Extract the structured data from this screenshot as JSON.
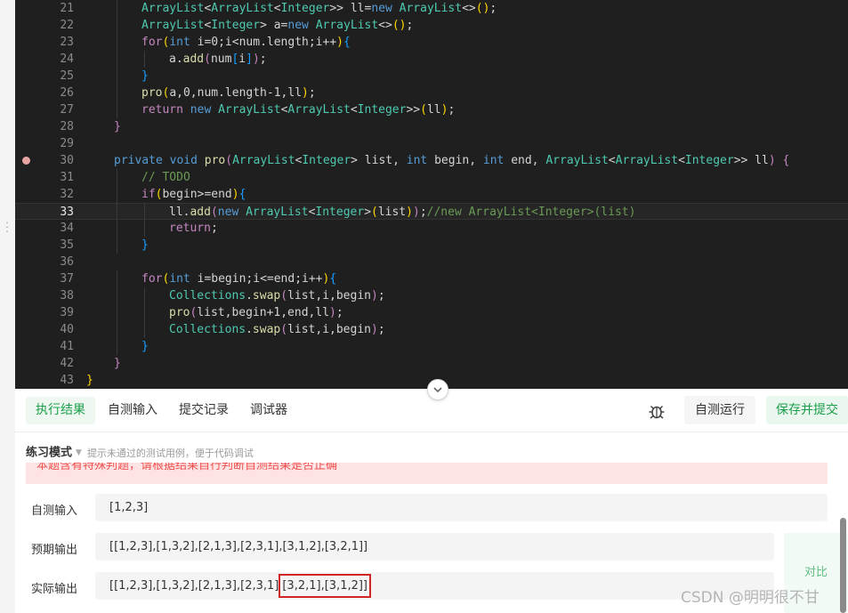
{
  "editor": {
    "lines": [
      {
        "num": "21",
        "indent": 2,
        "tokens": [
          [
            "t",
            "ArrayList"
          ],
          [
            "p",
            "<"
          ],
          [
            "t",
            "ArrayList"
          ],
          [
            "p",
            "<"
          ],
          [
            "t",
            "Integer"
          ],
          [
            "p",
            ">> ll="
          ],
          [
            "k",
            "new"
          ],
          [
            "p",
            " "
          ],
          [
            "t",
            "ArrayList"
          ],
          [
            "p",
            "<>"
          ],
          [
            "b2",
            "()"
          ],
          [
            "p",
            ";"
          ]
        ]
      },
      {
        "num": "22",
        "indent": 2,
        "tokens": [
          [
            "t",
            "ArrayList"
          ],
          [
            "p",
            "<"
          ],
          [
            "t",
            "Integer"
          ],
          [
            "p",
            "> a="
          ],
          [
            "k",
            "new"
          ],
          [
            "p",
            " "
          ],
          [
            "t",
            "ArrayList"
          ],
          [
            "p",
            "<>"
          ],
          [
            "b2",
            "()"
          ],
          [
            "p",
            ";"
          ]
        ]
      },
      {
        "num": "23",
        "indent": 2,
        "tokens": [
          [
            "b1",
            "for"
          ],
          [
            "b2",
            "("
          ],
          [
            "k",
            "int"
          ],
          [
            "p",
            " i=0;i<num.length;i++"
          ],
          [
            "b2",
            ")"
          ],
          [
            "b3",
            "{"
          ]
        ]
      },
      {
        "num": "24",
        "indent": 3,
        "tokens": [
          [
            "p",
            "a."
          ],
          [
            "f",
            "add"
          ],
          [
            "b1",
            "("
          ],
          [
            "p",
            "num"
          ],
          [
            "b3",
            "["
          ],
          [
            "p",
            "i"
          ],
          [
            "b3",
            "]"
          ],
          [
            "b1",
            ")"
          ],
          [
            "p",
            ";"
          ]
        ]
      },
      {
        "num": "25",
        "indent": 2,
        "tokens": [
          [
            "b3",
            "}"
          ]
        ]
      },
      {
        "num": "26",
        "indent": 2,
        "tokens": [
          [
            "f",
            "pro"
          ],
          [
            "b2",
            "("
          ],
          [
            "p",
            "a,0,num.length-1,ll"
          ],
          [
            "b2",
            ")"
          ],
          [
            "p",
            ";"
          ]
        ]
      },
      {
        "num": "27",
        "indent": 2,
        "tokens": [
          [
            "b1",
            "return"
          ],
          [
            "p",
            " "
          ],
          [
            "k",
            "new"
          ],
          [
            "p",
            " "
          ],
          [
            "t",
            "ArrayList"
          ],
          [
            "p",
            "<"
          ],
          [
            "t",
            "ArrayList"
          ],
          [
            "p",
            "<"
          ],
          [
            "t",
            "Integer"
          ],
          [
            "p",
            ">>"
          ],
          [
            "b2",
            "("
          ],
          [
            "p",
            "ll"
          ],
          [
            "b2",
            ")"
          ],
          [
            "p",
            ";"
          ]
        ]
      },
      {
        "num": "28",
        "indent": 1,
        "tokens": [
          [
            "b1",
            "}"
          ]
        ]
      },
      {
        "num": "29",
        "indent": 0,
        "tokens": []
      },
      {
        "num": "30",
        "indent": 1,
        "breakpoint": true,
        "tokens": [
          [
            "k",
            "private"
          ],
          [
            "p",
            " "
          ],
          [
            "k",
            "void"
          ],
          [
            "p",
            " "
          ],
          [
            "f",
            "pro"
          ],
          [
            "b1",
            "("
          ],
          [
            "t",
            "ArrayList"
          ],
          [
            "p",
            "<"
          ],
          [
            "t",
            "Integer"
          ],
          [
            "p",
            "> list, "
          ],
          [
            "k",
            "int"
          ],
          [
            "p",
            " begin, "
          ],
          [
            "k",
            "int"
          ],
          [
            "p",
            " end, "
          ],
          [
            "t",
            "ArrayList"
          ],
          [
            "p",
            "<"
          ],
          [
            "t",
            "ArrayList"
          ],
          [
            "p",
            "<"
          ],
          [
            "t",
            "Integer"
          ],
          [
            "p",
            ">> ll"
          ],
          [
            "b1",
            ")"
          ],
          [
            "p",
            " "
          ],
          [
            "b1",
            "{"
          ]
        ]
      },
      {
        "num": "31",
        "indent": 2,
        "tokens": [
          [
            "c",
            "// TODO"
          ]
        ]
      },
      {
        "num": "32",
        "indent": 2,
        "tokens": [
          [
            "b1",
            "if"
          ],
          [
            "b2",
            "("
          ],
          [
            "p",
            "begin>=end"
          ],
          [
            "b2",
            ")"
          ],
          [
            "b3",
            "{"
          ]
        ]
      },
      {
        "num": "33",
        "indent": 3,
        "current": true,
        "tokens": [
          [
            "p",
            "ll."
          ],
          [
            "f",
            "add"
          ],
          [
            "b1",
            "("
          ],
          [
            "k",
            "new"
          ],
          [
            "p",
            " "
          ],
          [
            "t",
            "ArrayList"
          ],
          [
            "p",
            "<"
          ],
          [
            "t",
            "Integer"
          ],
          [
            "p",
            ">"
          ],
          [
            "b2",
            "("
          ],
          [
            "p",
            "list"
          ],
          [
            "b2",
            ")"
          ],
          [
            "b1",
            ")"
          ],
          [
            "p",
            ";"
          ],
          [
            "c",
            "//new ArrayList<Integer>(list)"
          ]
        ]
      },
      {
        "num": "34",
        "indent": 3,
        "tokens": [
          [
            "b1",
            "return"
          ],
          [
            "p",
            ";"
          ]
        ]
      },
      {
        "num": "35",
        "indent": 2,
        "tokens": [
          [
            "b3",
            "}"
          ]
        ]
      },
      {
        "num": "36",
        "indent": 0,
        "tokens": []
      },
      {
        "num": "37",
        "indent": 2,
        "tokens": [
          [
            "b1",
            "for"
          ],
          [
            "b2",
            "("
          ],
          [
            "k",
            "int"
          ],
          [
            "p",
            " i=begin;i<=end;i++"
          ],
          [
            "b2",
            ")"
          ],
          [
            "b3",
            "{"
          ]
        ]
      },
      {
        "num": "38",
        "indent": 3,
        "tokens": [
          [
            "t",
            "Collections"
          ],
          [
            "p",
            "."
          ],
          [
            "f",
            "swap"
          ],
          [
            "b1",
            "("
          ],
          [
            "p",
            "list,i,begin"
          ],
          [
            "b1",
            ")"
          ],
          [
            "p",
            ";"
          ]
        ]
      },
      {
        "num": "39",
        "indent": 3,
        "tokens": [
          [
            "f",
            "pro"
          ],
          [
            "b1",
            "("
          ],
          [
            "p",
            "list,begin+1,end,ll"
          ],
          [
            "b1",
            ")"
          ],
          [
            "p",
            ";"
          ]
        ]
      },
      {
        "num": "40",
        "indent": 3,
        "tokens": [
          [
            "t",
            "Collections"
          ],
          [
            "p",
            "."
          ],
          [
            "f",
            "swap"
          ],
          [
            "b1",
            "("
          ],
          [
            "p",
            "list,i,begin"
          ],
          [
            "b1",
            ")"
          ],
          [
            "p",
            ";"
          ]
        ]
      },
      {
        "num": "41",
        "indent": 2,
        "tokens": [
          [
            "b3",
            "}"
          ]
        ]
      },
      {
        "num": "42",
        "indent": 1,
        "tokens": [
          [
            "b1",
            "}"
          ]
        ]
      },
      {
        "num": "43",
        "indent": 0,
        "tokens": [
          [
            "b2",
            "}"
          ]
        ]
      }
    ]
  },
  "tabs": [
    {
      "label": "执行结果",
      "active": true
    },
    {
      "label": "自测输入",
      "active": false
    },
    {
      "label": "提交记录",
      "active": false
    },
    {
      "label": "调试器",
      "active": false
    }
  ],
  "toolbar": {
    "debug_icon": "bug-icon",
    "run_label": "自测运行",
    "submit_label": "保存并提交"
  },
  "mode": {
    "label": "练习模式",
    "hint": "提示未通过的测试用例，便于代码调试"
  },
  "alert": {
    "text": "本题含有特殊判题，请根据结果自行判断自测结果是否正确"
  },
  "results": {
    "input_label": "自测输入",
    "input_value": "[1,2,3]",
    "expected_label": "预期输出",
    "expected_value": "[[1,2,3],[1,3,2],[2,1,3],[2,3,1],[3,1,2],[3,2,1]]",
    "actual_label": "实际输出",
    "actual_prefix": "[[1,2,3],[1,3,2],[2,1,3],[2,3,1]",
    "actual_highlight": "[3,2,1],[3,1,2]]",
    "compare_label": "对比"
  },
  "watermark": "CSDN @明明很不甘",
  "colors": {
    "accent": "#1c9f4a",
    "editor_bg": "#1f1f1f",
    "alert_bg": "#fde3e3",
    "highlight_border": "#d12525"
  }
}
